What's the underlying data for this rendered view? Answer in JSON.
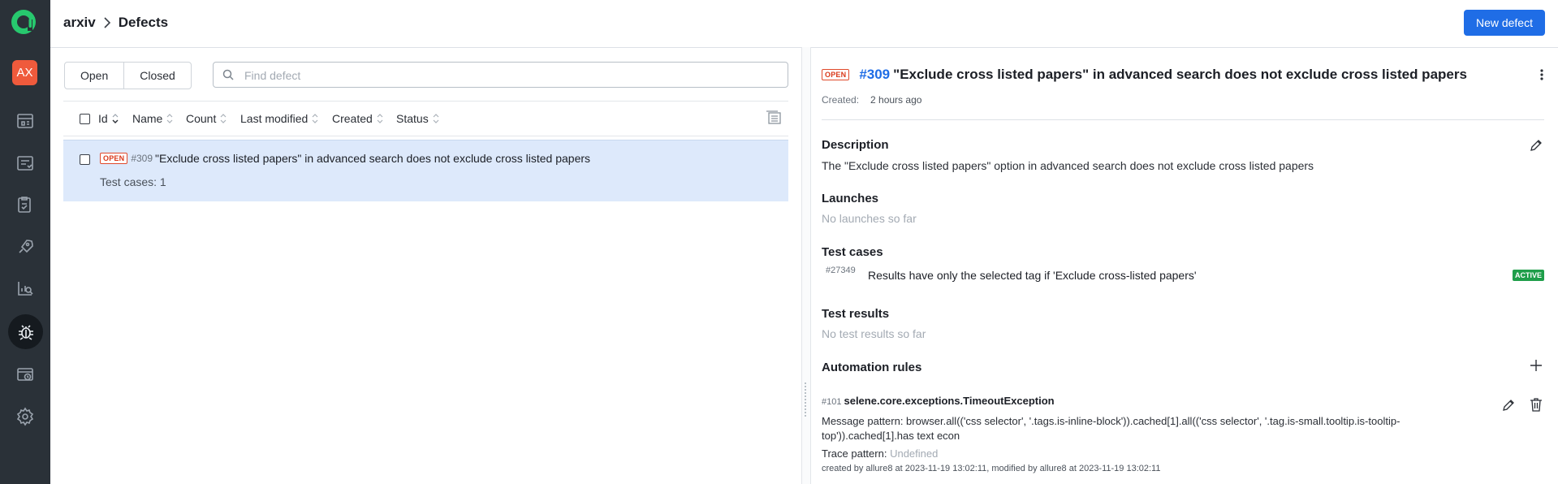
{
  "sidebar": {
    "avatar": "AX",
    "items": [
      {
        "icon": "dashboard-icon"
      },
      {
        "icon": "test-cases-icon"
      },
      {
        "icon": "test-plans-icon"
      },
      {
        "icon": "launches-icon"
      },
      {
        "icon": "analytics-icon"
      },
      {
        "icon": "defects-icon",
        "active": true
      },
      {
        "icon": "jobs-icon"
      },
      {
        "icon": "settings-icon"
      }
    ]
  },
  "header": {
    "project": "arxiv",
    "page": "Defects",
    "new_button": "New defect"
  },
  "filter": {
    "open_label": "Open",
    "closed_label": "Closed",
    "search_placeholder": "Find defect"
  },
  "table": {
    "columns": [
      "Id",
      "Name",
      "Count",
      "Last modified",
      "Created",
      "Status"
    ],
    "rows": [
      {
        "status": "OPEN",
        "id": "#309",
        "name": "\"Exclude cross listed papers\" in advanced search does not exclude cross listed papers",
        "test_cases": "Test cases: 1"
      }
    ]
  },
  "detail": {
    "status": "OPEN",
    "id": "#309",
    "title": "\"Exclude cross listed papers\" in advanced search does not exclude cross listed papers",
    "created_label": "Created:",
    "created_value": "2 hours ago",
    "description_title": "Description",
    "description": "The \"Exclude cross listed papers\" option in advanced search does not exclude cross listed papers",
    "launches_title": "Launches",
    "launches_empty": "No launches so far",
    "test_cases_title": "Test cases",
    "test_case": {
      "id": "#27349",
      "name": "Results have only the selected tag if 'Exclude cross-listed papers'",
      "status": "ACTIVE"
    },
    "test_results_title": "Test results",
    "test_results_empty": "No test results so far",
    "automation_title": "Automation rules",
    "rule": {
      "id": "#101",
      "name": "selene.core.exceptions.TimeoutException",
      "message_line1": "Message pattern: browser.all(('css selector', '.tags.is-inline-block')).cached[1].all(('css selector', '.tag.is-small.tooltip.is-tooltip-",
      "message_line2": "top')).cached[1].has text econ",
      "trace_label": "Trace pattern:",
      "trace_value": "Undefined",
      "footer": "created by allure8 at 2023-11-19 13:02:11, modified by allure8 at 2023-11-19 13:02:11"
    }
  },
  "colors": {
    "sidebar": "#2a3138",
    "primary": "#1f6de6",
    "open": "#d9391a",
    "active": "#1f9e4a",
    "selected_row": "#dde9fb"
  }
}
